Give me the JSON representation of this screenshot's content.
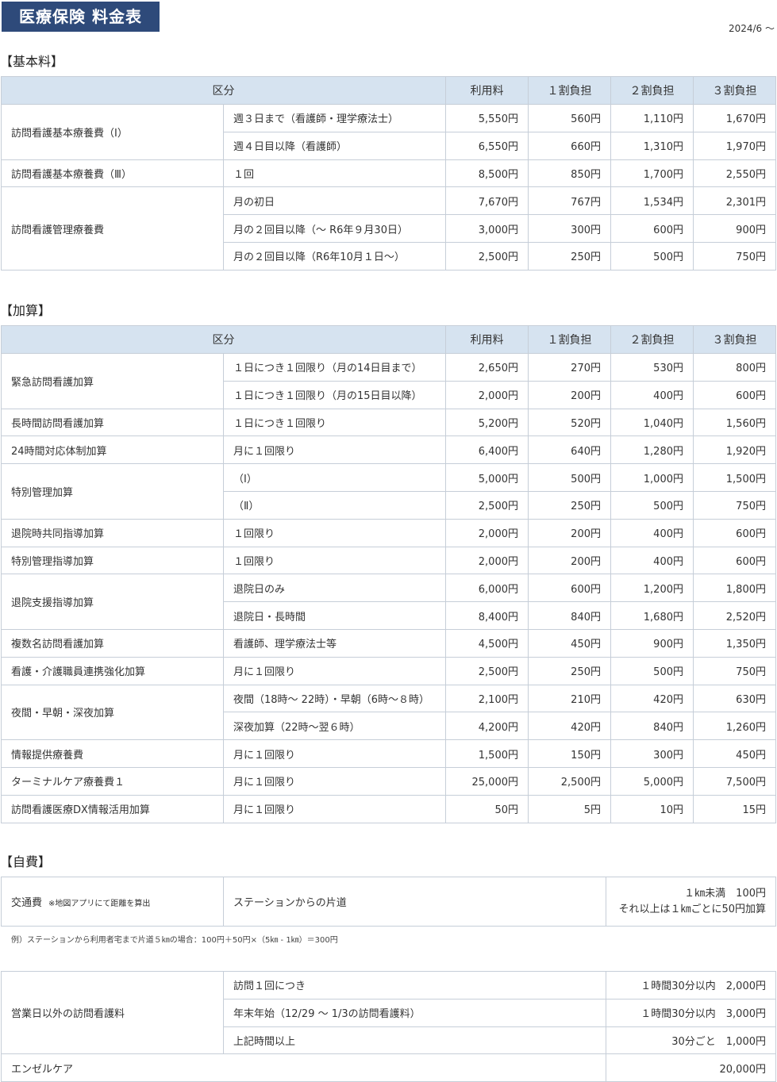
{
  "page_title": "医療保険 料金表",
  "effective_date": "2024/6 〜",
  "headers": {
    "category": "区分",
    "usage_fee": "利用料",
    "pct10": "１割負担",
    "pct20": "２割負担",
    "pct30": "３割負担"
  },
  "basic": {
    "title": "【基本料】",
    "groups": [
      {
        "name": "訪問看護基本療養費（Ⅰ）",
        "rows": [
          {
            "desc": "週３日まで（看護師・理学療法士）",
            "fee": "5,550円",
            "p10": "560円",
            "p20": "1,110円",
            "p30": "1,670円"
          },
          {
            "desc": "週４日目以降（看護師）",
            "fee": "6,550円",
            "p10": "660円",
            "p20": "1,310円",
            "p30": "1,970円"
          }
        ]
      },
      {
        "name": "訪問看護基本療養費（Ⅲ）",
        "rows": [
          {
            "desc": "１回",
            "fee": "8,500円",
            "p10": "850円",
            "p20": "1,700円",
            "p30": "2,550円"
          }
        ]
      },
      {
        "name": "訪問看護管理療養費",
        "rows": [
          {
            "desc": "月の初日",
            "fee": "7,670円",
            "p10": "767円",
            "p20": "1,534円",
            "p30": "2,301円"
          },
          {
            "desc": "月の２回目以降（〜 R6年９月30日）",
            "fee": "3,000円",
            "p10": "300円",
            "p20": "600円",
            "p30": "900円"
          },
          {
            "desc": "月の２回目以降（R6年10月１日〜）",
            "fee": "2,500円",
            "p10": "250円",
            "p20": "500円",
            "p30": "750円"
          }
        ]
      }
    ]
  },
  "addon": {
    "title": "【加算】",
    "groups": [
      {
        "name": "緊急訪問看護加算",
        "rows": [
          {
            "desc": "１日につき１回限り（月の14日目まで）",
            "fee": "2,650円",
            "p10": "270円",
            "p20": "530円",
            "p30": "800円"
          },
          {
            "desc": "１日につき１回限り（月の15日目以降）",
            "fee": "2,000円",
            "p10": "200円",
            "p20": "400円",
            "p30": "600円"
          }
        ]
      },
      {
        "name": "長時間訪問看護加算",
        "rows": [
          {
            "desc": "１日につき１回限り",
            "fee": "5,200円",
            "p10": "520円",
            "p20": "1,040円",
            "p30": "1,560円"
          }
        ]
      },
      {
        "name": "24時間対応体制加算",
        "rows": [
          {
            "desc": "月に１回限り",
            "fee": "6,400円",
            "p10": "640円",
            "p20": "1,280円",
            "p30": "1,920円"
          }
        ]
      },
      {
        "name": "特別管理加算",
        "rows": [
          {
            "desc": "（Ⅰ）",
            "fee": "5,000円",
            "p10": "500円",
            "p20": "1,000円",
            "p30": "1,500円"
          },
          {
            "desc": "（Ⅱ）",
            "fee": "2,500円",
            "p10": "250円",
            "p20": "500円",
            "p30": "750円"
          }
        ]
      },
      {
        "name": "退院時共同指導加算",
        "rows": [
          {
            "desc": "１回限り",
            "fee": "2,000円",
            "p10": "200円",
            "p20": "400円",
            "p30": "600円"
          }
        ]
      },
      {
        "name": "特別管理指導加算",
        "rows": [
          {
            "desc": "１回限り",
            "fee": "2,000円",
            "p10": "200円",
            "p20": "400円",
            "p30": "600円"
          }
        ]
      },
      {
        "name": "退院支援指導加算",
        "rows": [
          {
            "desc": "退院日のみ",
            "fee": "6,000円",
            "p10": "600円",
            "p20": "1,200円",
            "p30": "1,800円"
          },
          {
            "desc": "退院日・長時間",
            "fee": "8,400円",
            "p10": "840円",
            "p20": "1,680円",
            "p30": "2,520円"
          }
        ]
      },
      {
        "name": "複数名訪問看護加算",
        "rows": [
          {
            "desc": "看護師、理学療法士等",
            "fee": "4,500円",
            "p10": "450円",
            "p20": "900円",
            "p30": "1,350円"
          }
        ]
      },
      {
        "name": "看護・介護職員連携強化加算",
        "rows": [
          {
            "desc": "月に１回限り",
            "fee": "2,500円",
            "p10": "250円",
            "p20": "500円",
            "p30": "750円"
          }
        ]
      },
      {
        "name": "夜間・早朝・深夜加算",
        "rows": [
          {
            "desc": "夜間（18時〜 22時）・早朝（6時〜８時）",
            "fee": "2,100円",
            "p10": "210円",
            "p20": "420円",
            "p30": "630円"
          },
          {
            "desc": "深夜加算（22時〜翌６時）",
            "fee": "4,200円",
            "p10": "420円",
            "p20": "840円",
            "p30": "1,260円"
          }
        ]
      },
      {
        "name": "情報提供療養費",
        "rows": [
          {
            "desc": "月に１回限り",
            "fee": "1,500円",
            "p10": "150円",
            "p20": "300円",
            "p30": "450円"
          }
        ]
      },
      {
        "name": "ターミナルケア療養費１",
        "rows": [
          {
            "desc": "月に１回限り",
            "fee": "25,000円",
            "p10": "2,500円",
            "p20": "5,000円",
            "p30": "7,500円"
          }
        ]
      },
      {
        "name": "訪問看護医療DX情報活用加算",
        "rows": [
          {
            "desc": "月に１回限り",
            "fee": "50円",
            "p10": "5円",
            "p20": "10円",
            "p30": "15円"
          }
        ]
      }
    ]
  },
  "selfpay": {
    "title": "【自費】",
    "transport": {
      "name": "交通費",
      "note": "※地図アプリにて距離を算出",
      "desc": "ステーションからの片道",
      "price_line1": "１㎞未満　100円",
      "price_line2": "それ以上は１㎞ごとに50円加算"
    },
    "example": "例）ステーションから利用者宅まで片道５㎞の場合：100円＋50円×（5㎞ - 1㎞）＝300円",
    "off_hours": {
      "name": "営業日以外の訪問看護料",
      "rows": [
        {
          "desc": "訪問１回につき",
          "price": "１時間30分以内　2,000円"
        },
        {
          "desc": "年末年始（12/29 〜 1/3の訪問看護料）",
          "price": "１時間30分以内　3,000円"
        },
        {
          "desc": "上記時間以上",
          "price": "30分ごと　1,000円"
        }
      ]
    },
    "angel_care": {
      "name": "エンゼルケア",
      "price": "20,000円"
    }
  }
}
